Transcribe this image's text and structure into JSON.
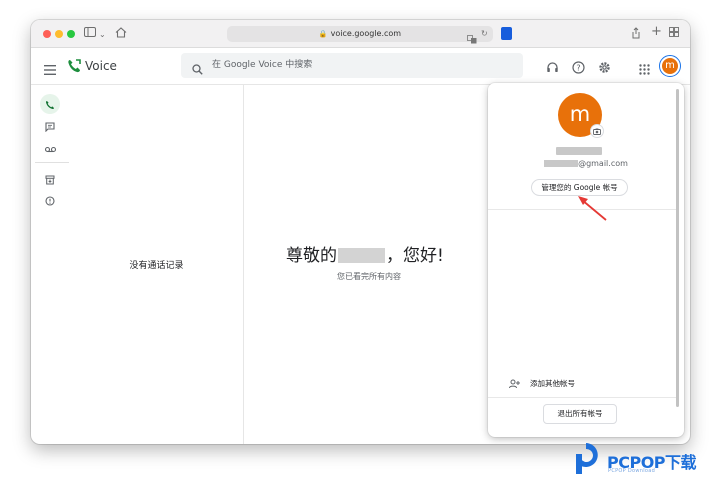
{
  "browser": {
    "url": "voice.google.com"
  },
  "app": {
    "name": "Voice",
    "search_placeholder": "在 Google Voice 中搜索",
    "avatar_letter": "m"
  },
  "list": {
    "empty_text": "没有通话记录"
  },
  "main": {
    "greeting_prefix": "尊敬的",
    "greeting_suffix": "，您好!",
    "subtitle": "您已看完所有内容"
  },
  "account_panel": {
    "avatar_letter": "m",
    "email_suffix": "@gmail.com",
    "manage_label": "管理您的 Google 帐号",
    "add_account_label": "添加其他帐号",
    "signout_label": "退出所有帐号"
  },
  "watermark": {
    "brand": "PCPOP下载",
    "sub": "PCPOP Download"
  },
  "colors": {
    "avatar": "#e8710a",
    "voice_green": "#1e8e3e",
    "active_rail_bg": "#e6f4ea",
    "arrow": "#e53935",
    "watermark": "#1e6fd9"
  }
}
